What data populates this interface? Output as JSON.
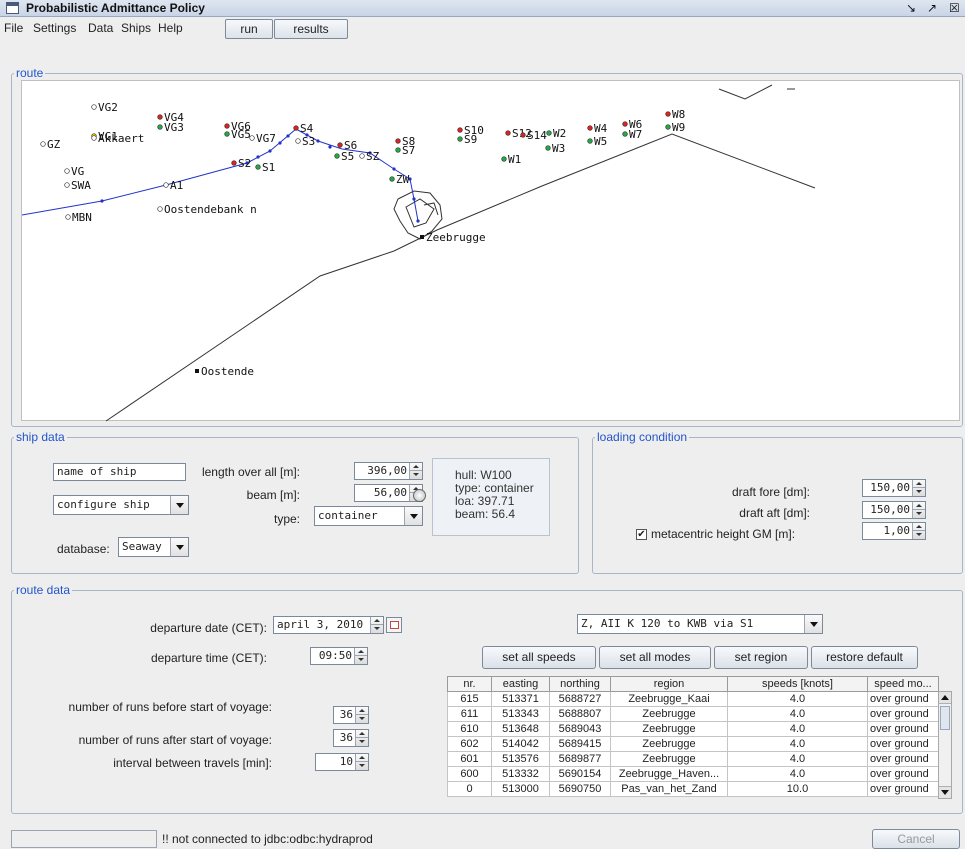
{
  "window": {
    "title": "Probabilistic Admittance Policy",
    "controls": [
      "↗",
      "⤢",
      "☒"
    ]
  },
  "menu": {
    "file": "File",
    "settings": "Settings",
    "data": "Data",
    "ships": "Ships",
    "help": "Help",
    "run": "run",
    "results": "results"
  },
  "route": {
    "legend": "route",
    "points": [
      {
        "name": "VG2",
        "color": "white"
      },
      {
        "name": "VG4",
        "color": "red"
      },
      {
        "name": "VG3",
        "color": "green"
      },
      {
        "name": "VG6",
        "color": "red"
      },
      {
        "name": "VG5",
        "color": "green"
      },
      {
        "name": "VG7",
        "color": "white"
      },
      {
        "name": "S4",
        "color": "red"
      },
      {
        "name": "S3",
        "color": "white"
      },
      {
        "name": "S6",
        "color": "red"
      },
      {
        "name": "S5",
        "color": "green"
      },
      {
        "name": "SZ",
        "color": "white"
      },
      {
        "name": "S8",
        "color": "red"
      },
      {
        "name": "S7",
        "color": "green"
      },
      {
        "name": "S10",
        "color": "red"
      },
      {
        "name": "S9",
        "color": "green"
      },
      {
        "name": "S12",
        "color": "red"
      },
      {
        "name": "S14",
        "color": "red"
      },
      {
        "name": "W2",
        "color": "green"
      },
      {
        "name": "W1",
        "color": "green"
      },
      {
        "name": "W3",
        "color": "green"
      },
      {
        "name": "W4",
        "color": "red"
      },
      {
        "name": "W5",
        "color": "green"
      },
      {
        "name": "W6",
        "color": "red"
      },
      {
        "name": "W7",
        "color": "green"
      },
      {
        "name": "W8",
        "color": "red"
      },
      {
        "name": "W9",
        "color": "green"
      },
      {
        "name": "GZ",
        "color": "white"
      },
      {
        "name": "VG1",
        "color": "yellow"
      },
      {
        "name": "Akkaert",
        "color": "white"
      },
      {
        "name": "S2",
        "color": "red"
      },
      {
        "name": "S1",
        "color": "green"
      },
      {
        "name": "VG",
        "color": "white"
      },
      {
        "name": "SWA",
        "color": "white"
      },
      {
        "name": "A1",
        "color": "white"
      },
      {
        "name": "ZW",
        "color": "green"
      },
      {
        "name": "MBN",
        "color": "white"
      },
      {
        "name": "Oostendebank n",
        "color": "white"
      },
      {
        "name": "Zeebrugge",
        "color": "black"
      },
      {
        "name": "Oostende",
        "color": "black"
      }
    ],
    "colors": {
      "red": "#dd2222",
      "green": "#22aa44",
      "white": "#ffffff",
      "yellow": "#f0d000",
      "black": "#111111",
      "route": "#2233cc",
      "coast": "#333333"
    }
  },
  "ship_data": {
    "legend": "ship data",
    "name_field": "name of ship",
    "loa_label": "length over all [m]:",
    "loa_value": "396,00",
    "beam_label": "beam [m]:",
    "beam_value": "56,00",
    "type_label": "type:",
    "type_value": "container",
    "configure": "configure ship",
    "database_label": "database:",
    "database_value": "Seaway",
    "hull_lines": [
      "hull: W100",
      "type: container",
      "loa: 397.71",
      "beam: 56.4"
    ]
  },
  "loading": {
    "legend": "loading condition",
    "draft_fore_label": "draft fore [dm]:",
    "draft_fore_value": "150,00",
    "draft_aft_label": "draft aft [dm]:",
    "draft_aft_value": "150,00",
    "gm_label": "metacentric height GM [m]:",
    "gm_value": "1,00",
    "gm_checked": true
  },
  "route_data": {
    "legend": "route data",
    "departure_date_label": "departure date (CET):",
    "departure_date_value": "april 3, 2010",
    "departure_time_label": "departure time (CET):",
    "departure_time_value": "09:50",
    "runs_before_label": "number of runs before start of voyage:",
    "runs_before_value": "36",
    "runs_after_label": "number of runs after start of voyage:",
    "runs_after_value": "36",
    "interval_label": "interval between travels [min]:",
    "interval_value": "10",
    "route_select": "Z, AII K 120 to KWB via S1",
    "buttons": {
      "set_speeds": "set all speeds",
      "set_modes": "set all modes",
      "set_region": "set region",
      "restore": "restore default"
    },
    "table": {
      "headers": [
        "nr.",
        "easting",
        "northing",
        "region",
        "speeds [knots]",
        "speed mo..."
      ],
      "rows": [
        [
          "615",
          "513371",
          "5688727",
          "Zeebrugge_Kaai",
          "4.0",
          "over ground"
        ],
        [
          "611",
          "513343",
          "5688807",
          "Zeebrugge",
          "4.0",
          "over ground"
        ],
        [
          "610",
          "513648",
          "5689043",
          "Zeebrugge",
          "4.0",
          "over ground"
        ],
        [
          "602",
          "514042",
          "5689415",
          "Zeebrugge",
          "4.0",
          "over ground"
        ],
        [
          "601",
          "513576",
          "5689877",
          "Zeebrugge",
          "4.0",
          "over ground"
        ],
        [
          "600",
          "513332",
          "5690154",
          "Zeebrugge_Haven...",
          "4.0",
          "over ground"
        ],
        [
          "0",
          "513000",
          "5690750",
          "Pas_van_het_Zand",
          "10.0",
          "over ground"
        ]
      ]
    }
  },
  "status": {
    "message": "!! not connected to jdbc:odbc:hydraprod",
    "cancel": "Cancel"
  }
}
